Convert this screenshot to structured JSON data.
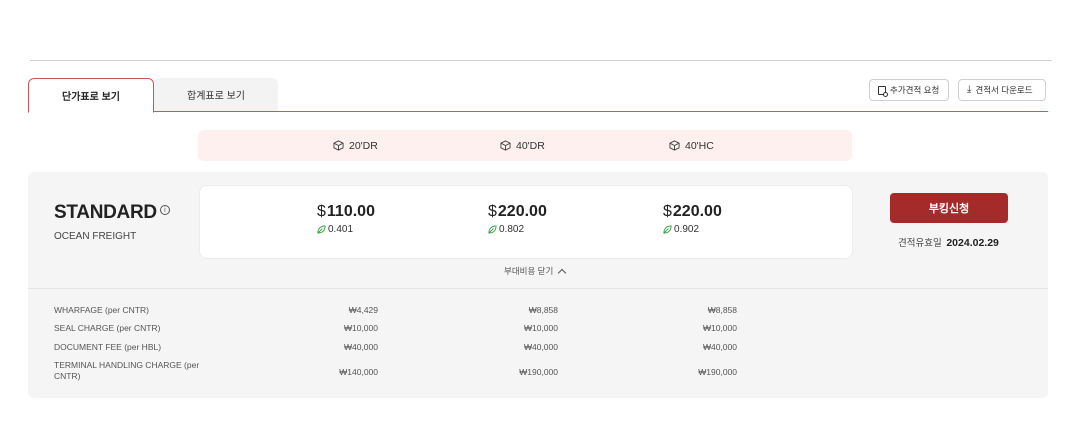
{
  "tabs": {
    "unit_price": "단가표로 보기",
    "total_price": "합계표로 보기"
  },
  "actions": {
    "additional_quote": "추가견적 요청",
    "download_quote": "견적서 다운로드"
  },
  "containers": [
    {
      "label": "20'DR"
    },
    {
      "label": "40'DR"
    },
    {
      "label": "40'HC"
    }
  ],
  "service": {
    "name": "STANDARD",
    "info_icon": "info-icon",
    "category": "OCEAN FREIGHT",
    "prices": [
      {
        "currency": "$",
        "amount": "110.00",
        "ratio": "0.401"
      },
      {
        "currency": "$",
        "amount": "220.00",
        "ratio": "0.802"
      },
      {
        "currency": "$",
        "amount": "220.00",
        "ratio": "0.902"
      }
    ],
    "book_label": "부킹신청",
    "validity_label": "견적유효일",
    "validity_date": "2024.02.29",
    "toggle_label": "부대비용 닫기"
  },
  "charges": [
    {
      "name": "WHARFAGE (per CNTR)",
      "values": [
        "₩4,429",
        "₩8,858",
        "₩8,858"
      ]
    },
    {
      "name": "SEAL CHARGE (per CNTR)",
      "values": [
        "₩10,000",
        "₩10,000",
        "₩10,000"
      ]
    },
    {
      "name": "DOCUMENT FEE (per HBL)",
      "values": [
        "₩40,000",
        "₩40,000",
        "₩40,000"
      ]
    },
    {
      "name": "TERMINAL HANDLING CHARGE (per CNTR)",
      "values": [
        "₩140,000",
        "₩190,000",
        "₩190,000"
      ]
    }
  ],
  "colors": {
    "accent": "#a52a2a",
    "tab_border": "#c9565a",
    "header_tint": "#fdf0ef",
    "eco_green": "#2e9a3a"
  }
}
